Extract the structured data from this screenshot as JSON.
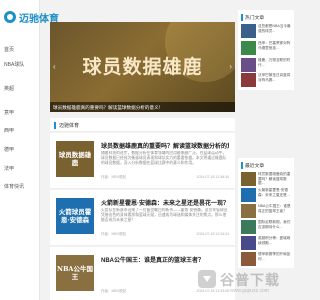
{
  "brand": {
    "logo_text": "迈驰体育",
    "accent_color": "#1e90c8"
  },
  "nav": {
    "items": [
      {
        "label": "首页"
      },
      {
        "label": "NBA球队"
      },
      {
        "label": "英超"
      },
      {
        "label": "意甲"
      },
      {
        "label": "西甲"
      },
      {
        "label": "德甲"
      },
      {
        "label": "法甲"
      },
      {
        "label": "体育快讯"
      }
    ]
  },
  "banner": {
    "title": "球员数据雄鹿",
    "caption": "球员数据雄鹿真的重要吗？解读篮球数据分析的意义！",
    "prev_icon": "‹",
    "next_icon": "›"
  },
  "list": {
    "heading": "迈驰体育",
    "articles": [
      {
        "thumb_text": "球员数据雄鹿",
        "thumb_color": "#7a6130",
        "title": "球员数据雄鹿真的重要吗？解读篮球数据分析的意...",
        "excerpt": "随着科技的进步，数据分析在体育领域的应用越来越广泛，在篮球运动中，球员数据已经成为衡量球员表现和球队实力的重要依据。本文将通过雄鹿队的球员数据，深入分析数据在篮球比赛中的意义和作用。",
        "author": "作者：MBV脱贴",
        "time": "2024-07-18 12:36:34"
      },
      {
        "thumb_text": "火箭球员霍恩·安德森",
        "thumb_color": "#1f6fb0",
        "title": "火箭新星霍恩·安德森：未来之星还是昙花一现？",
        "excerpt": "火箭队在新赛季迎来了一位备受瞩目的新秀——霍恩·安德森。这位年轻球员凭借出色的身体素质和篮球天赋，迅速成为球迷和媒体关注的焦点。那么他能否成为未来之星？",
        "author": "作者：MBV脱贴",
        "time": "2024-07-18 12:34:24"
      },
      {
        "thumb_text": "NBA公牛国王",
        "thumb_color": "#8a7040",
        "title": "NBA公牛国王：谁是真正的篮球王者？",
        "excerpt": "",
        "author": "作者：MBV脱贴",
        "time": "2024-07-18 12:33:05"
      }
    ]
  },
  "sidebar": {
    "hot_heading": "热门文章",
    "hot_items": [
      {
        "text": "这些都是NBA当今最强的球员...",
        "color": "#3a5f8a"
      },
      {
        "text": "西甲：巴塞罗那对阵马德里竞技...",
        "color": "#3b8a4a"
      },
      {
        "text": "雄鹿，万物互联的时代...",
        "color": "#6a4e8a"
      },
      {
        "text": "法甲巴黎圣日耳曼将对阵马赛...",
        "color": "#8a3a3a"
      }
    ],
    "latest_heading": "最近文章",
    "latest_items": [
      {
        "text": "球员数据雄鹿真的重要吗？解读篮球数据...",
        "color": "#7a6130"
      },
      {
        "text": "火箭新星霍恩·安德森：未来之星还是...",
        "color": "#1f6fb0"
      },
      {
        "text": "NBA公牛国王：谁是真正的篮球王者？",
        "color": "#8a7040"
      },
      {
        "text": "国际足联新规，我们应该期待什么...",
        "color": "#3b7a5a"
      },
      {
        "text": "英超积分榜：曼城继续领跑...",
        "color": "#4a4a8a"
      },
      {
        "text": "德甲新赛季的开局如何...",
        "color": "#8a5a3a"
      }
    ]
  },
  "watermark": {
    "text": "谷普下载",
    "sub": "www.gupuxz.com"
  }
}
